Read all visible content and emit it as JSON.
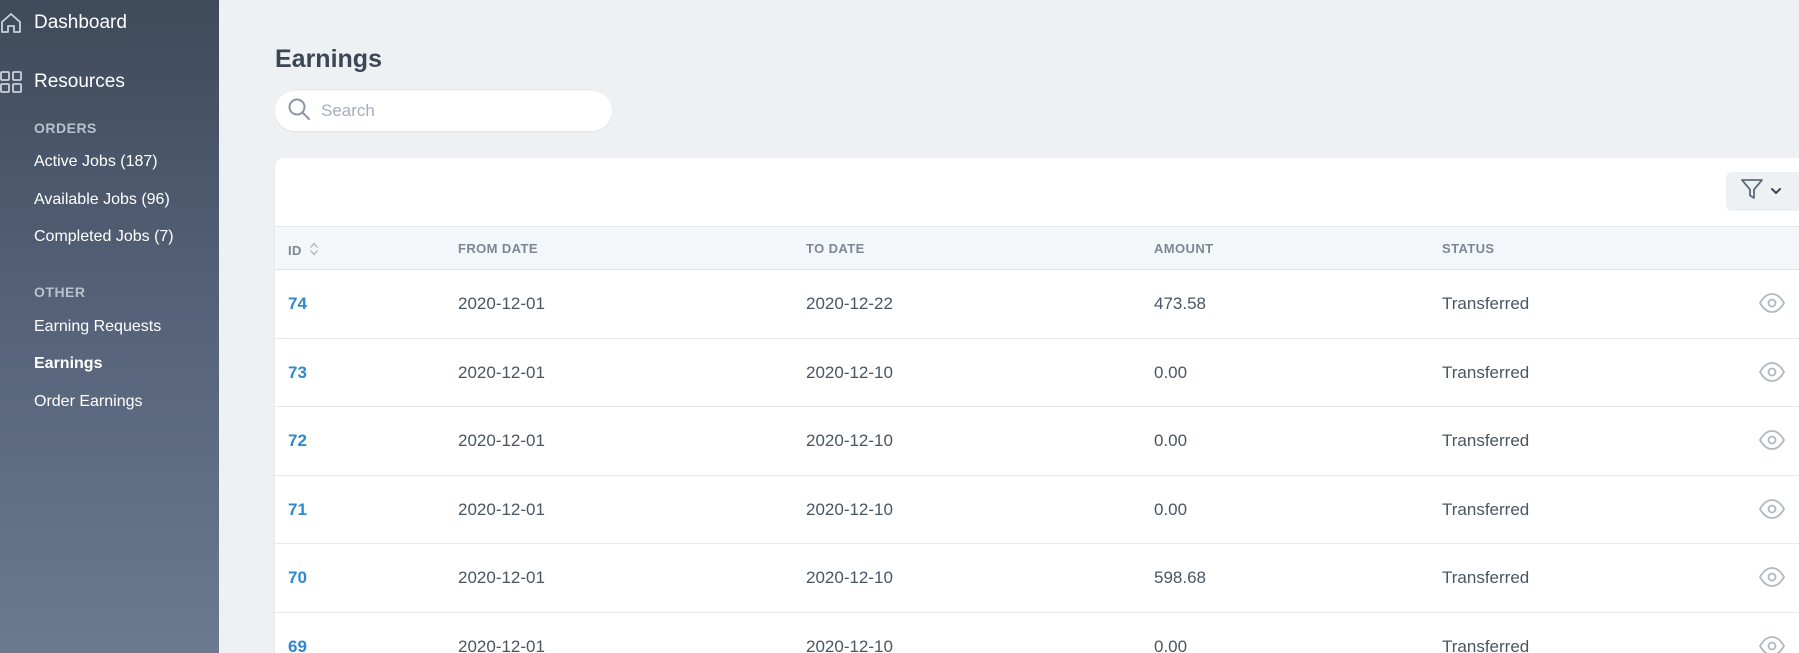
{
  "sidebar": {
    "dashboard": "Dashboard",
    "resources": "Resources",
    "orders_heading": "ORDERS",
    "orders_links": [
      "Active Jobs (187)",
      "Available Jobs (96)",
      "Completed Jobs (7)"
    ],
    "other_heading": "OTHER",
    "other_links": [
      "Earning Requests",
      "Earnings",
      "Order Earnings"
    ],
    "active_link": "Earnings"
  },
  "page": {
    "title": "Earnings",
    "search_placeholder": "Search"
  },
  "table": {
    "columns": [
      "ID",
      "FROM DATE",
      "TO DATE",
      "AMOUNT",
      "STATUS"
    ],
    "rows": [
      {
        "id": "74",
        "from": "2020-12-01",
        "to": "2020-12-22",
        "amount": "473.58",
        "status": "Transferred"
      },
      {
        "id": "73",
        "from": "2020-12-01",
        "to": "2020-12-10",
        "amount": "0.00",
        "status": "Transferred"
      },
      {
        "id": "72",
        "from": "2020-12-01",
        "to": "2020-12-10",
        "amount": "0.00",
        "status": "Transferred"
      },
      {
        "id": "71",
        "from": "2020-12-01",
        "to": "2020-12-10",
        "amount": "0.00",
        "status": "Transferred"
      },
      {
        "id": "70",
        "from": "2020-12-01",
        "to": "2020-12-10",
        "amount": "598.68",
        "status": "Transferred"
      },
      {
        "id": "69",
        "from": "2020-12-01",
        "to": "2020-12-10",
        "amount": "0.00",
        "status": "Transferred"
      }
    ]
  },
  "icons": {
    "dashboard": "home-icon",
    "resources": "grid-icon",
    "search": "search-icon",
    "filter": "filter-icon",
    "view": "eye-icon",
    "sort": "sort-icon"
  },
  "colors": {
    "accent": "#2f88d1",
    "sidebar_top": "#3f4a5a",
    "sidebar_bottom": "#6b7a8f",
    "background": "#eef1f4"
  }
}
